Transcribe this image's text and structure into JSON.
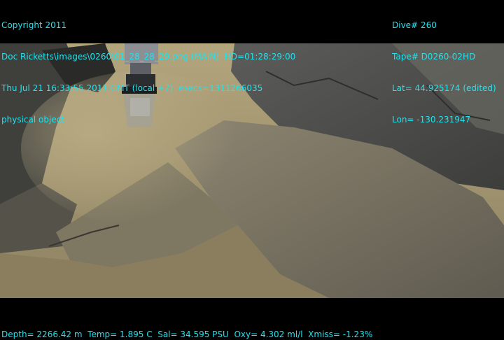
{
  "overlay": {
    "top_left": [
      "Copyright 2011",
      "Doc Ricketts\\images\\0260\\01_28_28_29.png (MAIN)  HD=01:28:29:00",
      "Thu Jul 21 16:33:55 2011 GMT (local +7)  esecs=1311266035",
      "physical object"
    ],
    "top_right": [
      "Dive# 260",
      "Tape# D0260-02HD",
      "Lat= 44.925174 (edited)",
      "Lon= -130.231947"
    ],
    "bottom": "Depth= 2266.42 m  Temp= 1.895 C  Sal= 34.595 PSU  Oxy= 4.302 ml/l  Xmiss= -1.23%"
  },
  "colors": {
    "overlay_text": "#1fe3ef",
    "sediment": "#a89a72",
    "rock_dark": "#4a4a48",
    "rock_mid": "#6e6a5e"
  }
}
